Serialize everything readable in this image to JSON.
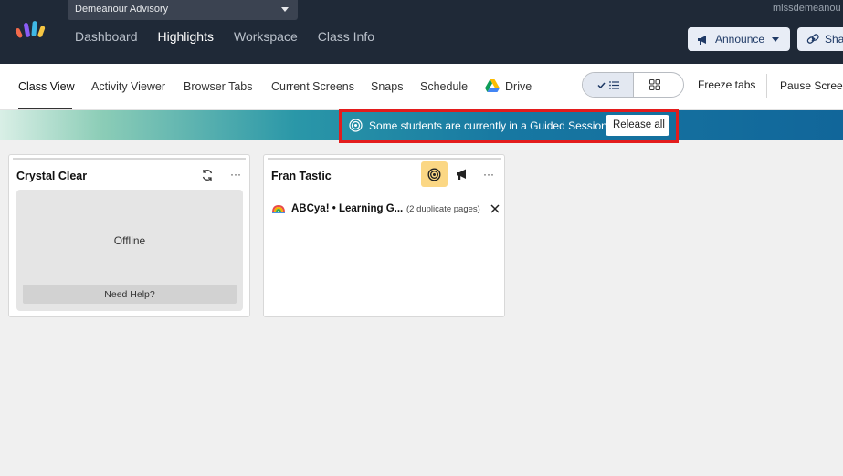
{
  "header": {
    "class_selector": "Demeanour Advisory",
    "nav": [
      "Dashboard",
      "Highlights",
      "Workspace",
      "Class Info"
    ],
    "active_nav": "Highlights",
    "user": "missdemeanou",
    "announce_label": "Announce",
    "share_label": "Sha"
  },
  "tabs": {
    "items": [
      "Class View",
      "Activity Viewer",
      "Browser Tabs",
      "Current Screens",
      "Snaps",
      "Schedule",
      "Drive"
    ],
    "active": "Class View",
    "freeze_label": "Freeze tabs",
    "pause_label": "Pause Screer"
  },
  "banner": {
    "message": "Some students are currently in a Guided Session",
    "release_label": "Release all"
  },
  "students": [
    {
      "name": "Crystal Clear",
      "status": "Offline",
      "help_label": "Need Help?",
      "icons": [
        "refresh-icon",
        "more-icon"
      ]
    },
    {
      "name": "Fran Tastic",
      "icons": [
        "target-icon",
        "megaphone-icon",
        "more-icon"
      ],
      "open_tab": {
        "title": "ABCya! • Learning G...",
        "note": "(2 duplicate pages)"
      }
    }
  ],
  "colors": {
    "topbar": "#1f2937",
    "banner_start": "#d9efe6",
    "banner_end": "#11669a",
    "highlight": "#e31c1c",
    "guided_active": "#fbd784"
  }
}
